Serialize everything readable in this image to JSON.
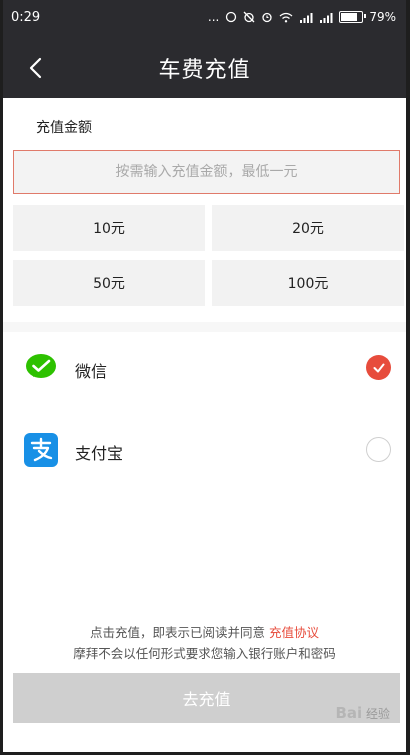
{
  "status_bar": {
    "time": "0:29",
    "dots": "...",
    "battery_percent": "79%"
  },
  "header": {
    "title": "车费充值"
  },
  "amount": {
    "section_label": "充值金额",
    "input_placeholder": "按需输入充值金额，最低一元",
    "input_value": "",
    "options": [
      "10元",
      "20元",
      "50元",
      "100元"
    ]
  },
  "payment": {
    "selected_index": 0,
    "methods": [
      {
        "label": "微信",
        "icon": "wechat-pay-icon",
        "selected": true,
        "color": "#2dc100"
      },
      {
        "label": "支付宝",
        "icon": "alipay-icon",
        "selected": false,
        "color": "#1890e6"
      }
    ]
  },
  "notice": {
    "line1_prefix": "点击充值，即表示已阅读并同意 ",
    "agreement_link": "充值协议",
    "line2": "摩拜不会以任何形式要求您输入银行账户和密码"
  },
  "submit_label": "去充值",
  "watermark": {
    "brand": "Bai",
    "sub": "经验"
  },
  "colors": {
    "accent": "#e74c3c",
    "header_bg": "#2b2b2f",
    "input_border": "#e07a6a"
  }
}
